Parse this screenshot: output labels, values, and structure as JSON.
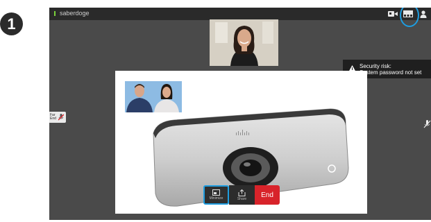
{
  "step_number": "1",
  "topbar": {
    "device_name": "saberdoge",
    "icons": [
      "camera-icon",
      "layout-icon",
      "person-icon"
    ]
  },
  "alert": {
    "title": "Security risk:",
    "message": "System password not set",
    "icon": "warning-triangle-icon"
  },
  "far_end": {
    "label": "Far End"
  },
  "controls": {
    "minimize_label": "Minimize",
    "share_label": "Share",
    "end_label": "End"
  },
  "colors": {
    "accent": "#1e9de0",
    "end_red": "#d8232a",
    "status_green": "#7ad23a"
  }
}
